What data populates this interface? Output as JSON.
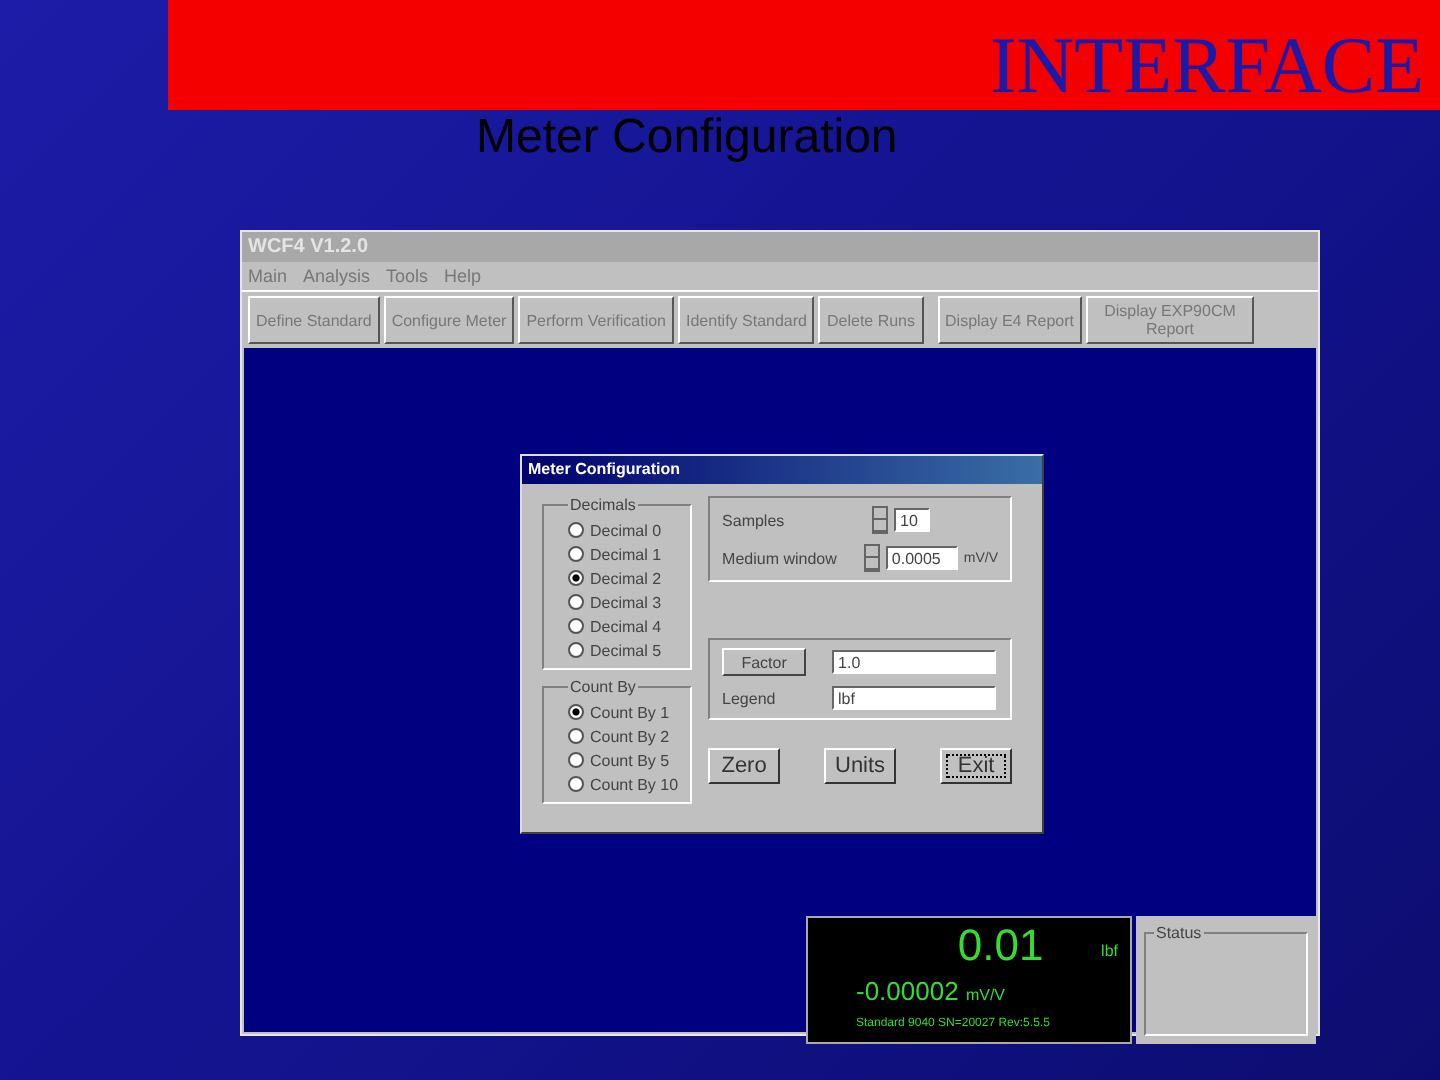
{
  "slide": {
    "heading": "INTERFACE",
    "subtitle": "Meter Configuration"
  },
  "window": {
    "title": "WCF4 V1.2.0"
  },
  "menu": [
    "Main",
    "Analysis",
    "Tools",
    "Help"
  ],
  "toolbar": [
    [
      "Define Standard",
      "Configure Meter",
      "Perform Verification",
      "Identify Standard",
      "Delete Runs"
    ],
    [
      "Display E4 Report",
      "Display EXP90CM Report"
    ]
  ],
  "dialog": {
    "title": "Meter Configuration",
    "decimals": {
      "label": "Decimals",
      "options": [
        {
          "label": "Decimal 0",
          "selected": false
        },
        {
          "label": "Decimal 1",
          "selected": false
        },
        {
          "label": "Decimal 2",
          "selected": true
        },
        {
          "label": "Decimal 3",
          "selected": false
        },
        {
          "label": "Decimal 4",
          "selected": false
        },
        {
          "label": "Decimal 5",
          "selected": false
        }
      ]
    },
    "count_by": {
      "label": "Count By",
      "options": [
        {
          "label": "Count By 1",
          "selected": true
        },
        {
          "label": "Count By 2",
          "selected": false
        },
        {
          "label": "Count By 5",
          "selected": false
        },
        {
          "label": "Count By 10",
          "selected": false
        }
      ]
    },
    "samples": {
      "label": "Samples",
      "value": "10"
    },
    "window_field": {
      "label": "Medium window",
      "value": "0.0005",
      "unit": "mV/V"
    },
    "factor": {
      "label": "Factor",
      "value": "1.0"
    },
    "legend": {
      "label": "Legend",
      "value": "lbf"
    },
    "buttons": [
      {
        "label": "Zero",
        "focused": false
      },
      {
        "label": "Units",
        "focused": false
      },
      {
        "label": "Exit",
        "focused": true
      }
    ]
  },
  "display": {
    "reading": "0.01",
    "unit": "lbf",
    "signal": "-0.00002",
    "signal_unit": "mV/V",
    "info": "Standard 9040 SN=20027 Rev:5.5.5"
  },
  "status": {
    "label": "Status"
  }
}
